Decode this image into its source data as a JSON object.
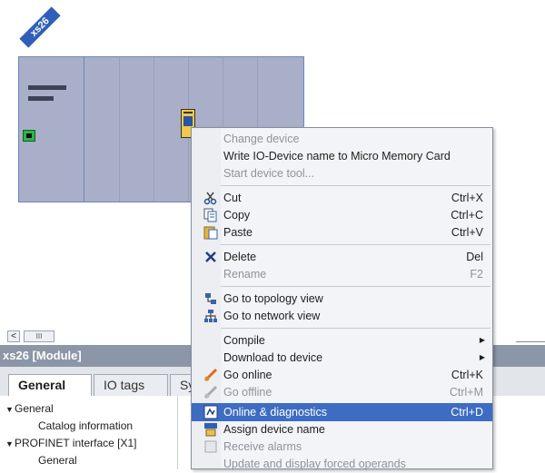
{
  "device": {
    "name": "xs26"
  },
  "scrollbar": {
    "thumb_label": "III",
    "left_arrow": "<"
  },
  "properties": {
    "title": "xs26 [Module]",
    "tabs": [
      {
        "label": "General",
        "active": true
      },
      {
        "label": "IO tags",
        "active": false
      },
      {
        "label": "Sys",
        "active": false
      }
    ],
    "nav": [
      {
        "label": "General",
        "expanded": true,
        "level": 0
      },
      {
        "label": "Catalog information",
        "level": 1
      },
      {
        "label": "PROFINET interface [X1]",
        "expanded": true,
        "level": 0
      },
      {
        "label": "General",
        "level": 1
      }
    ]
  },
  "context_menu": {
    "items": [
      {
        "label": "Change device",
        "disabled": true,
        "icon": ""
      },
      {
        "label": "Write IO-Device name to Micro Memory Card",
        "icon": ""
      },
      {
        "label": "Start device tool...",
        "disabled": true,
        "icon": ""
      },
      {
        "label": "Cut",
        "shortcut": "Ctrl+X",
        "icon": "scissors-icon"
      },
      {
        "label": "Copy",
        "shortcut": "Ctrl+C",
        "icon": "copy-icon"
      },
      {
        "label": "Paste",
        "shortcut": "Ctrl+V",
        "icon": "paste-icon"
      },
      {
        "label": "Delete",
        "shortcut": "Del",
        "icon": "delete-icon"
      },
      {
        "label": "Rename",
        "shortcut": "F2",
        "disabled": true,
        "icon": ""
      },
      {
        "label": "Go to topology view",
        "icon": "topology-icon"
      },
      {
        "label": "Go to network view",
        "icon": "network-icon"
      },
      {
        "label": "Compile",
        "submenu": true,
        "icon": ""
      },
      {
        "label": "Download to device",
        "submenu": true,
        "icon": ""
      },
      {
        "label": "Go online",
        "shortcut": "Ctrl+K",
        "icon": "go-online-icon"
      },
      {
        "label": "Go offline",
        "shortcut": "Ctrl+M",
        "disabled": true,
        "icon": "go-offline-icon"
      },
      {
        "label": "Online & diagnostics",
        "shortcut": "Ctrl+D",
        "highlighted": true,
        "icon": "diagnostics-icon"
      },
      {
        "label": "Assign device name",
        "icon": "name-icon"
      },
      {
        "label": "Receive alarms",
        "disabled": true,
        "icon": "alarm-checkbox-icon"
      },
      {
        "label": "Update and display forced operands",
        "disabled": true,
        "icon": ""
      }
    ]
  },
  "colors": {
    "accent": "#3d6cc3",
    "rack": "#a9afc8",
    "title_bar": "#8b96a6",
    "device_tag": "#2f5fb8"
  }
}
